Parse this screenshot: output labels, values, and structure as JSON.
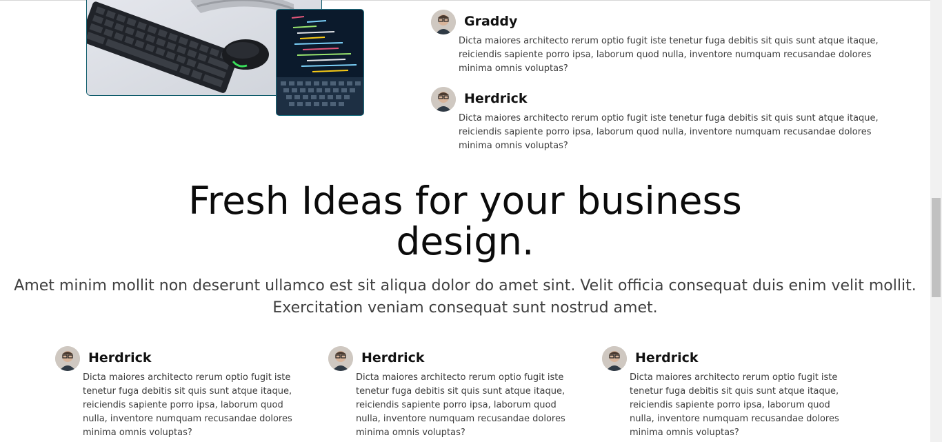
{
  "testimonials_top": [
    {
      "name": "Graddy",
      "text": "Dicta maiores architecto rerum optio fugit iste tenetur fuga debitis sit quis sunt atque itaque, reiciendis sapiente porro ipsa, laborum quod nulla, inventore numquam recusandae dolores minima omnis voluptas?"
    },
    {
      "name": "Herdrick",
      "text": "Dicta maiores architecto rerum optio fugit iste tenetur fuga debitis sit quis sunt atque itaque, reiciendis sapiente porro ipsa, laborum quod nulla, inventore numquam recusandae dolores minima omnis voluptas?"
    }
  ],
  "hero": {
    "title_line1": "Fresh Ideas for your business",
    "title_line2": "design.",
    "subtitle_line1": "Amet minim mollit non deserunt ullamco est sit aliqua dolor do amet sint. Velit officia consequat duis enim velit mollit.",
    "subtitle_line2": "Exercitation veniam consequat sunt nostrud amet."
  },
  "testimonials_bottom": [
    {
      "name": "Herdrick",
      "text": "Dicta maiores architecto rerum optio fugit iste tenetur fuga debitis sit quis sunt atque itaque, reiciendis sapiente porro ipsa, laborum quod nulla, inventore numquam recusandae dolores minima omnis voluptas?"
    },
    {
      "name": "Herdrick",
      "text": "Dicta maiores architecto rerum optio fugit iste tenetur fuga debitis sit quis sunt atque itaque, reiciendis sapiente porro ipsa, laborum quod nulla, inventore numquam recusandae dolores minima omnis voluptas?"
    },
    {
      "name": "Herdrick",
      "text": "Dicta maiores architecto rerum optio fugit iste tenetur fuga debitis sit quis sunt atque itaque, reiciendis sapiente porro ipsa, laborum quod nulla, inventore numquam recusandae dolores minima omnis voluptas?"
    }
  ],
  "colors": {
    "image_border": "#0f5c6b",
    "heading": "#0b0b0b",
    "body_text": "#3b3b3b",
    "scroll_thumb": "#c1c1c1"
  },
  "icons": {
    "avatar": "person-avatar-icon"
  }
}
